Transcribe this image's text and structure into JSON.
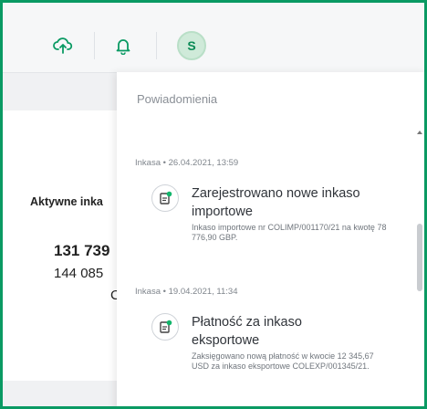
{
  "header": {
    "avatar_initial": "S"
  },
  "background": {
    "section_title": "Aktywne inka",
    "value_1": "131 739",
    "value_2": "144 085",
    "value_3": "C"
  },
  "notifications": {
    "title": "Powiadomienia",
    "items": [
      {
        "category": "Inkasa",
        "datetime": "26.04.2021, 13:59",
        "title": "Zarejestrowano nowe inkaso importowe",
        "description": "Inkaso importowe nr COLIMP/001170/21 na kwotę 78 776,90 GBP."
      },
      {
        "category": "Inkasa",
        "datetime": "19.04.2021, 11:34",
        "title": "Płatność za inkaso eksportowe",
        "description": "Zaksięgowano nową płatność w kwocie 12 345,67 USD za inkaso eksportowe COLEXP/001345/21."
      }
    ]
  }
}
